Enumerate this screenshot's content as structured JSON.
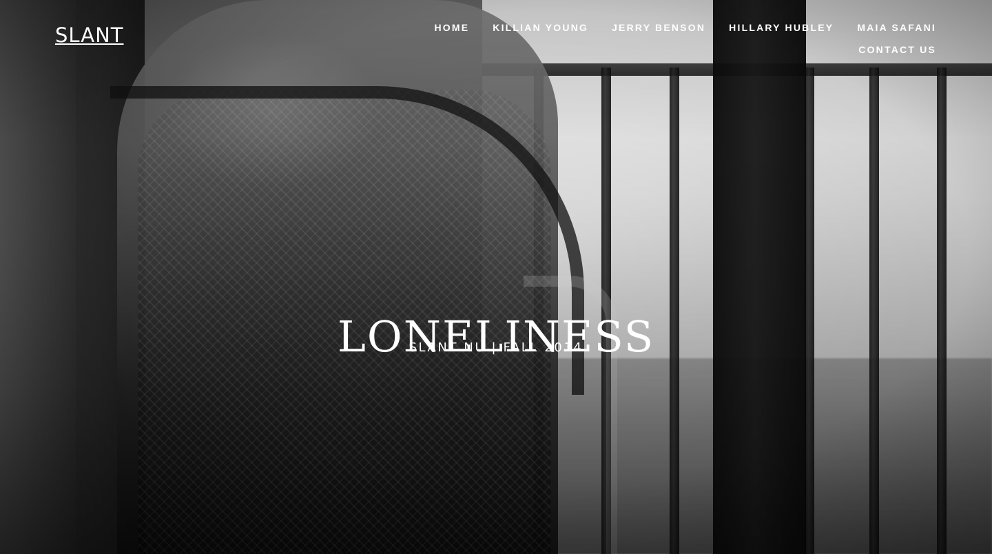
{
  "site": {
    "logo": "SLANT",
    "nav": [
      {
        "label": "HOME"
      },
      {
        "label": "KILLIAN YOUNG"
      },
      {
        "label": "JERRY BENSON"
      },
      {
        "label": "HILLARY HUBLEY"
      },
      {
        "label": "MAIA SAFANI"
      },
      {
        "label": "CONTACT US"
      }
    ]
  },
  "hero": {
    "title": "LONELINESS",
    "subtitle": "SLANT NU | FALL 2014",
    "scroll_icon": "chevron-down-icon"
  }
}
